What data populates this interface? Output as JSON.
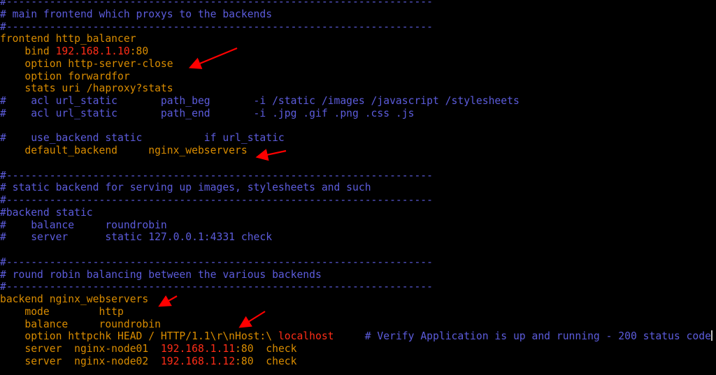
{
  "app": {
    "type": "terminal-editor",
    "content": "haproxy configuration"
  },
  "colors": {
    "background": "#000000",
    "comment": "#5c5cdc",
    "keyword": "#d98c00",
    "literal": "#ff2d17",
    "annotation_arrow": "#ff0000",
    "cursor": "#c0c0c0"
  },
  "lines": [
    [
      {
        "s": "c",
        "t": "#---------------------------------------------------------------------"
      }
    ],
    [
      {
        "s": "c",
        "t": "# main frontend which proxys to the backends"
      }
    ],
    [
      {
        "s": "c",
        "t": "#---------------------------------------------------------------------"
      }
    ],
    [
      {
        "s": "k",
        "t": "frontend http_balancer"
      }
    ],
    [
      {
        "s": "k",
        "t": "    bind "
      },
      {
        "s": "r",
        "t": "192.168.1.10"
      },
      {
        "s": "k",
        "t": ":80"
      }
    ],
    [
      {
        "s": "k",
        "t": "    option http-server-close"
      }
    ],
    [
      {
        "s": "k",
        "t": "    option forwardfor"
      }
    ],
    [
      {
        "s": "k",
        "t": "    stats uri /haproxy?stats"
      }
    ],
    [
      {
        "s": "c",
        "t": "#    acl url_static       path_beg       -i /static /images /javascript /stylesheets"
      }
    ],
    [
      {
        "s": "c",
        "t": "#    acl url_static       path_end       -i .jpg .gif .png .css .js"
      }
    ],
    [
      {
        "s": "c",
        "t": ""
      }
    ],
    [
      {
        "s": "c",
        "t": "#    use_backend static          if url_static"
      }
    ],
    [
      {
        "s": "k",
        "t": "    default_backend     nginx_webservers"
      }
    ],
    [
      {
        "s": "c",
        "t": ""
      }
    ],
    [
      {
        "s": "c",
        "t": "#---------------------------------------------------------------------"
      }
    ],
    [
      {
        "s": "c",
        "t": "# static backend for serving up images, stylesheets and such"
      }
    ],
    [
      {
        "s": "c",
        "t": "#---------------------------------------------------------------------"
      }
    ],
    [
      {
        "s": "c",
        "t": "#backend static"
      }
    ],
    [
      {
        "s": "c",
        "t": "#    balance     roundrobin"
      }
    ],
    [
      {
        "s": "c",
        "t": "#    server      static 127.0.0.1:4331 check"
      }
    ],
    [
      {
        "s": "c",
        "t": ""
      }
    ],
    [
      {
        "s": "c",
        "t": "#---------------------------------------------------------------------"
      }
    ],
    [
      {
        "s": "c",
        "t": "# round robin balancing between the various backends"
      }
    ],
    [
      {
        "s": "c",
        "t": "#---------------------------------------------------------------------"
      }
    ],
    [
      {
        "s": "k",
        "t": "backend nginx_webservers"
      }
    ],
    [
      {
        "s": "k",
        "t": "    mode        http"
      }
    ],
    [
      {
        "s": "k",
        "t": "    balance     roundrobin"
      }
    ],
    [
      {
        "s": "k",
        "t": "    option httpchk HEAD / HTTP/1.1\\r\\nHost:\\ "
      },
      {
        "s": "r",
        "t": "localhost"
      },
      {
        "s": "k",
        "t": "     "
      },
      {
        "s": "c",
        "t": "# Verify Application is up and running - 200 status code"
      },
      {
        "s": "cursor",
        "t": ""
      }
    ],
    [
      {
        "s": "k",
        "t": "    server  nginx-node01  "
      },
      {
        "s": "r",
        "t": "192.168.1.11"
      },
      {
        "s": "k",
        "t": ":80  check"
      }
    ],
    [
      {
        "s": "k",
        "t": "    server  nginx-node02  "
      },
      {
        "s": "r",
        "t": "192.168.1.12"
      },
      {
        "s": "k",
        "t": ":80  check"
      }
    ]
  ],
  "annotations": [
    {
      "name": "arrow-option-http-server-close",
      "points_to": "option http-server-close"
    },
    {
      "name": "arrow-default-backend",
      "points_to": "default_backend nginx_webservers"
    },
    {
      "name": "arrow-backend-nginx-webservers",
      "points_to": "backend nginx_webservers"
    },
    {
      "name": "arrow-option-httpchk",
      "points_to": "option httpchk HEAD / HTTP/1.1\\r\\nHost:\\ localhost"
    }
  ]
}
